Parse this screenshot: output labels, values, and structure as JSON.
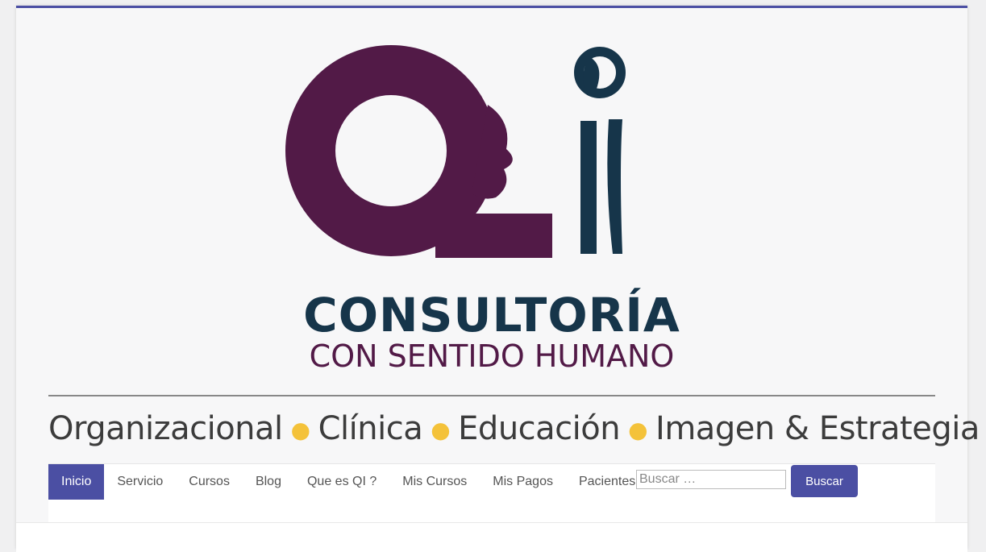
{
  "brand": {
    "title": "CONSULTORÍA",
    "subtitle": "CON SENTIDO HUMANO",
    "areas": [
      "Organizacional",
      "Clínica",
      "Educación",
      "Imagen & Estrategia"
    ],
    "logo_text": "Qi",
    "colors": {
      "purple": "#521a47",
      "navy": "#16354a",
      "dot": "#f4c23a"
    }
  },
  "nav": {
    "items": [
      {
        "label": "Inicio",
        "active": true
      },
      {
        "label": "Servicio"
      },
      {
        "label": "Cursos"
      },
      {
        "label": "Blog"
      },
      {
        "label": "Que es QI ?"
      },
      {
        "label": "Mis Cursos"
      },
      {
        "label": "Mis Pagos"
      },
      {
        "label": "Pacientes"
      }
    ],
    "active_color": "#4b4fa3"
  },
  "search": {
    "placeholder": "Buscar …",
    "button_label": "Buscar"
  }
}
